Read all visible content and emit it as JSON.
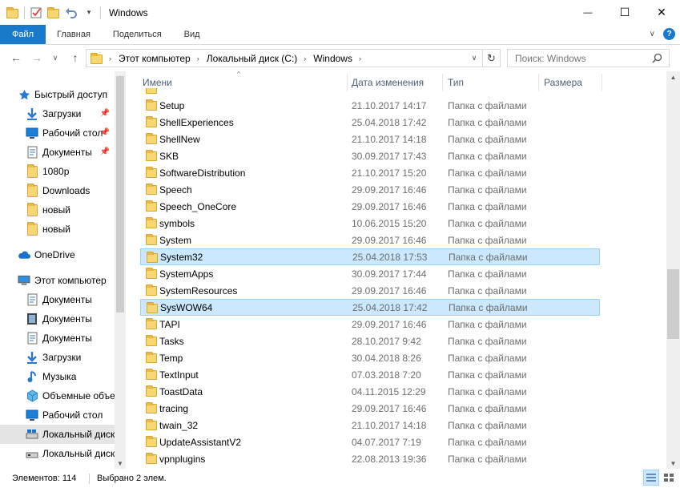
{
  "window": {
    "title": "Windows",
    "minimize": "—",
    "maximize": "☐",
    "close": "✕"
  },
  "ribbon": {
    "tabs": [
      "Файл",
      "Главная",
      "Поделиться",
      "Вид"
    ]
  },
  "address": {
    "crumbs": [
      "Этот компьютер",
      "Локальный диск (C:)",
      "Windows"
    ],
    "search_placeholder": "Поиск: Windows"
  },
  "nav": {
    "quick_access": "Быстрый доступ",
    "items": [
      {
        "label": "Загрузки",
        "icon": "download-icon",
        "pinned": true
      },
      {
        "label": "Рабочий стол",
        "icon": "desktop-icon",
        "pinned": true
      },
      {
        "label": "Документы",
        "icon": "documents-icon",
        "pinned": true
      },
      {
        "label": "1080p",
        "icon": "folder-icon"
      },
      {
        "label": "Downloads",
        "icon": "folder-icon"
      },
      {
        "label": "новый",
        "icon": "folder-icon"
      },
      {
        "label": "новый",
        "icon": "folder-icon"
      }
    ],
    "onedrive": "OneDrive",
    "this_pc": "Этот компьютер",
    "pc_items": [
      {
        "label": "Документы",
        "icon": "documents-icon"
      },
      {
        "label": "Документы",
        "icon": "video-icon"
      },
      {
        "label": "Документы",
        "icon": "documents-icon"
      },
      {
        "label": "Загрузки",
        "icon": "download-icon"
      },
      {
        "label": "Музыка",
        "icon": "music-icon"
      },
      {
        "label": "Объемные объекты",
        "icon": "3d-objects-icon"
      },
      {
        "label": "Рабочий стол",
        "icon": "desktop-icon"
      },
      {
        "label": "Локальный диск (C:)",
        "icon": "drive-icon",
        "selected": true
      },
      {
        "label": "Локальный диск (D:)",
        "icon": "drive-icon"
      }
    ]
  },
  "columns": {
    "name": "Имени",
    "date": "Дата изменения",
    "type": "Тип",
    "size": "Размера"
  },
  "files": [
    {
      "name": "Setup",
      "date": "21.10.2017 14:17",
      "type": "Папка с файлами"
    },
    {
      "name": "ShellExperiences",
      "date": "25.04.2018 17:42",
      "type": "Папка с файлами"
    },
    {
      "name": "ShellNew",
      "date": "21.10.2017 14:18",
      "type": "Папка с файлами"
    },
    {
      "name": "SKB",
      "date": "30.09.2017 17:43",
      "type": "Папка с файлами"
    },
    {
      "name": "SoftwareDistribution",
      "date": "21.10.2017 15:20",
      "type": "Папка с файлами"
    },
    {
      "name": "Speech",
      "date": "29.09.2017 16:46",
      "type": "Папка с файлами"
    },
    {
      "name": "Speech_OneCore",
      "date": "29.09.2017 16:46",
      "type": "Папка с файлами"
    },
    {
      "name": "symbols",
      "date": "10.06.2015 15:20",
      "type": "Папка с файлами"
    },
    {
      "name": "System",
      "date": "29.09.2017 16:46",
      "type": "Папка с файлами"
    },
    {
      "name": "System32",
      "date": "25.04.2018 17:53",
      "type": "Папка с файлами",
      "selected": true
    },
    {
      "name": "SystemApps",
      "date": "30.09.2017 17:44",
      "type": "Папка с файлами"
    },
    {
      "name": "SystemResources",
      "date": "29.09.2017 16:46",
      "type": "Папка с файлами"
    },
    {
      "name": "SysWOW64",
      "date": "25.04.2018 17:42",
      "type": "Папка с файлами",
      "selected": true
    },
    {
      "name": "TAPI",
      "date": "29.09.2017 16:46",
      "type": "Папка с файлами"
    },
    {
      "name": "Tasks",
      "date": "28.10.2017 9:42",
      "type": "Папка с файлами"
    },
    {
      "name": "Temp",
      "date": "30.04.2018 8:26",
      "type": "Папка с файлами"
    },
    {
      "name": "TextInput",
      "date": "07.03.2018 7:20",
      "type": "Папка с файлами"
    },
    {
      "name": "ToastData",
      "date": "04.11.2015 12:29",
      "type": "Папка с файлами"
    },
    {
      "name": "tracing",
      "date": "29.09.2017 16:46",
      "type": "Папка с файлами"
    },
    {
      "name": "twain_32",
      "date": "21.10.2017 14:18",
      "type": "Папка с файлами"
    },
    {
      "name": "UpdateAssistantV2",
      "date": "04.07.2017 7:19",
      "type": "Папка с файлами"
    },
    {
      "name": "vpnplugins",
      "date": "22.08.2013 19:36",
      "type": "Папка с файлами"
    }
  ],
  "status": {
    "count": "Элементов: 114",
    "selected": "Выбрано 2 элем."
  },
  "colors": {
    "accent": "#1979ca",
    "selection": "#cce8ff",
    "selection_border": "#99d1ff",
    "folder": "#f7d774"
  }
}
